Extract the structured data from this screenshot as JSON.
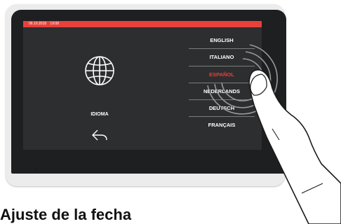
{
  "status_bar": {
    "date": "06.10.2018",
    "time": "19:08",
    "color": "#e8413a"
  },
  "panel": {
    "icon": "globe-icon",
    "title": "IDIOMA",
    "back_icon": "back-arrow-icon"
  },
  "languages": [
    {
      "label": "ENGLISH",
      "selected": false
    },
    {
      "label": "ITALIANO",
      "selected": false
    },
    {
      "label": "ESPAÑOL",
      "selected": true
    },
    {
      "label": "NEDERLANDS",
      "selected": false
    },
    {
      "label": "DEUTSCH",
      "selected": false
    },
    {
      "label": "FRANÇAIS",
      "selected": false
    }
  ],
  "caption": "Ajuste de la fecha",
  "colors": {
    "accent": "#e8413a",
    "screen": "#2d2e30",
    "bezel": "#1e1f21"
  }
}
